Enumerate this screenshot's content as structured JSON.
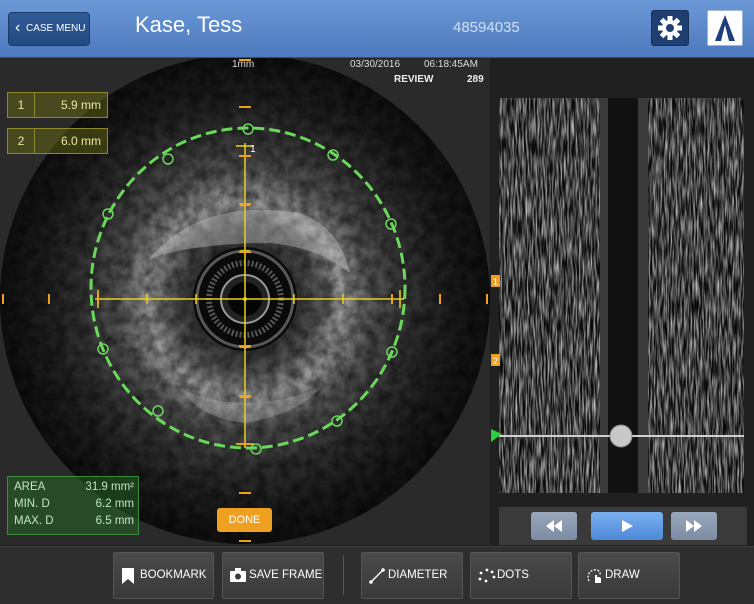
{
  "header": {
    "back_label": "CASE MENU",
    "patient_name": "Kase, Tess",
    "patient_id": "48594035"
  },
  "image_info": {
    "scale": "1mm",
    "date": "03/30/2016",
    "time": "06:18:45AM",
    "mode": "REVIEW",
    "frame": "289"
  },
  "measurements": [
    {
      "index": "1",
      "value": "5.9 mm"
    },
    {
      "index": "2",
      "value": "6.0 mm"
    }
  ],
  "stats": {
    "area_label": "AREA",
    "area_value": "31.9 mm²",
    "min_label": "MIN. D",
    "min_value": "6.2 mm",
    "max_label": "MAX. D",
    "max_value": "6.5 mm"
  },
  "contour_label": "1",
  "done_label": "DONE",
  "markers": [
    {
      "label": "1",
      "color": "#f0a020"
    },
    {
      "label": "2",
      "color": "#f0a020"
    }
  ],
  "toolbar": {
    "bookmark_label": "BOOKMARK",
    "save_frame_label": "SAVE FRAME",
    "diameter_label": "DIAMETER",
    "dots_label": "DOTS",
    "draw_label": "DRAW"
  },
  "colors": {
    "header": "#5b88cc",
    "accent_orange": "#f0a020",
    "contour_green": "#6ad85a",
    "crosshair_yellow": "#e8d020",
    "play_blue": "#4d89d8"
  },
  "icons": {
    "back": "chevron-left-icon",
    "settings": "gear-icon",
    "logo": "logo-icon",
    "bookmark": "bookmark-icon",
    "save_frame": "camera-icon",
    "diameter": "diameter-icon",
    "dots": "dots-icon",
    "draw": "draw-icon",
    "rewind": "rewind-icon",
    "play": "play-icon",
    "forward": "fast-forward-icon"
  }
}
